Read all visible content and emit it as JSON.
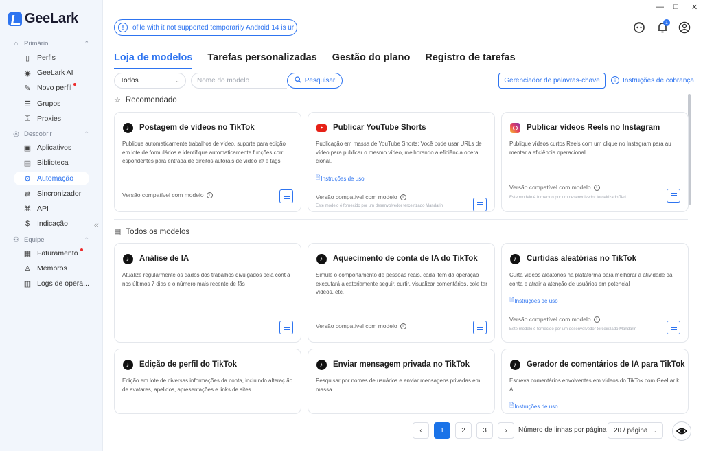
{
  "app": {
    "name": "GeeLark"
  },
  "window_controls": {
    "minimize": "—",
    "maximize": "□",
    "close": "✕"
  },
  "notice": {
    "text": "ofile with it not supported temporarily   Android 14 is ur"
  },
  "header_icons": {
    "support": "support-icon",
    "notifications": "bell-icon",
    "notification_count": "1",
    "profile": "user-icon"
  },
  "sidebar": {
    "sections": [
      {
        "label": "Primário",
        "icon": "home-icon"
      },
      {
        "label": "Descobrir",
        "icon": "compass-icon"
      },
      {
        "label": "Equipe",
        "icon": "team-icon"
      }
    ],
    "items": [
      {
        "label": "Perfis",
        "icon": "phone-icon"
      },
      {
        "label": "GeeLark AI",
        "icon": "ai-icon"
      },
      {
        "label": "Novo perfil",
        "icon": "edit-icon",
        "dot": true
      },
      {
        "label": "Grupos",
        "icon": "list-icon"
      },
      {
        "label": "Proxies",
        "icon": "proxy-icon"
      },
      {
        "label": "Aplicativos",
        "icon": "apps-icon"
      },
      {
        "label": "Biblioteca",
        "icon": "library-icon"
      },
      {
        "label": "Automação",
        "icon": "robot-icon",
        "active": true
      },
      {
        "label": "Sincronizador",
        "icon": "sync-icon"
      },
      {
        "label": "API",
        "icon": "api-icon"
      },
      {
        "label": "Indicação",
        "icon": "dollar-icon"
      },
      {
        "label": "Faturamento",
        "icon": "billing-icon",
        "dot": true
      },
      {
        "label": "Membros",
        "icon": "member-icon"
      },
      {
        "label": "Logs de opera...",
        "icon": "logs-icon"
      }
    ],
    "collapse": "«"
  },
  "tabs": [
    {
      "label": "Loja de modelos",
      "active": true
    },
    {
      "label": "Tarefas personalizadas"
    },
    {
      "label": "Gestão do plano"
    },
    {
      "label": "Registro de tarefas"
    }
  ],
  "filters": {
    "category": "Todos",
    "search_placeholder": "Nome do modelo",
    "search_button": "Pesquisar",
    "keywords_button": "Gerenciador de palavras-chave",
    "billing_link": "Instruções de cobrança"
  },
  "sections": {
    "recommended": "Recomendado",
    "all": "Todos os modelos"
  },
  "cards_labels": {
    "compat": "Versão compatível com modelo",
    "guide": "Instruções de uso"
  },
  "recommended_cards": [
    {
      "title": "Postagem de vídeos no TikTok",
      "icon": "tiktok-icon",
      "desc": "Publique automaticamente trabalhos de vídeo, suporte para edição em lote de formulários e identifique automaticamente funções corr espondentes para entrada de direitos autorais de vídeo @ e tags"
    },
    {
      "title": "Publicar YouTube Shorts",
      "icon": "youtube-icon",
      "desc": "Publicação em massa de YouTube Shorts: Você pode usar URLs de vídeo para publicar o mesmo vídeo, melhorando a eficiência opera cional.",
      "provider": "Este modelo é fornecido por um desenvolvedor terceirizado Mandarin"
    },
    {
      "title": "Publicar vídeos Reels no Instagram",
      "icon": "instagram-icon",
      "desc": "Publique vídeos curtos Reels com um clique no Instagram para au mentar a eficiência operacional",
      "provider": "Este modelo é fornecido por um desenvolvedor terceirizado Ted"
    }
  ],
  "all_cards": [
    {
      "title": "Análise de IA",
      "icon": "tiktok-icon",
      "desc": "Atualize regularmente os dados dos trabalhos divulgados pela cont a nos últimos 7 dias e o número mais recente de fãs"
    },
    {
      "title": "Aquecimento de conta de IA do TikTok",
      "icon": "tiktok-icon",
      "desc": "Simule o comportamento de pessoas reais, cada item da operação executará aleatoriamente seguir, curtir, visualizar comentários, cole tar vídeos, etc."
    },
    {
      "title": "Curtidas aleatórias no TikTok",
      "icon": "tiktok-icon",
      "desc": "Curta vídeos aleatórios na plataforma para melhorar a atividade da conta e atrair a atenção de usuários em potencial",
      "provider": "Este modelo é fornecido por um desenvolvedor terceirizado Mandarin"
    },
    {
      "title": "Edição de perfil do TikTok",
      "icon": "tiktok-icon",
      "desc": "Edição em lote de diversas informações da conta, incluindo alteraç ão de avatares, apelidos, apresentações e links de sites"
    },
    {
      "title": "Enviar mensagem privada no TikTok",
      "icon": "tiktok-icon",
      "desc": "Pesquisar por nomes de usuários e enviar mensagens privadas em massa."
    },
    {
      "title": "Gerador de comentários de IA para TikTok",
      "icon": "tiktok-icon",
      "desc": "Escreva comentários envolventes em vídeos do TikTok com GeeLar k AI"
    }
  ],
  "pagination": {
    "prev": "‹",
    "next": "›",
    "pages": [
      "1",
      "2",
      "3"
    ],
    "current": "1",
    "rows_label": "Número de linhas por página",
    "rows_value": "20 / página"
  }
}
